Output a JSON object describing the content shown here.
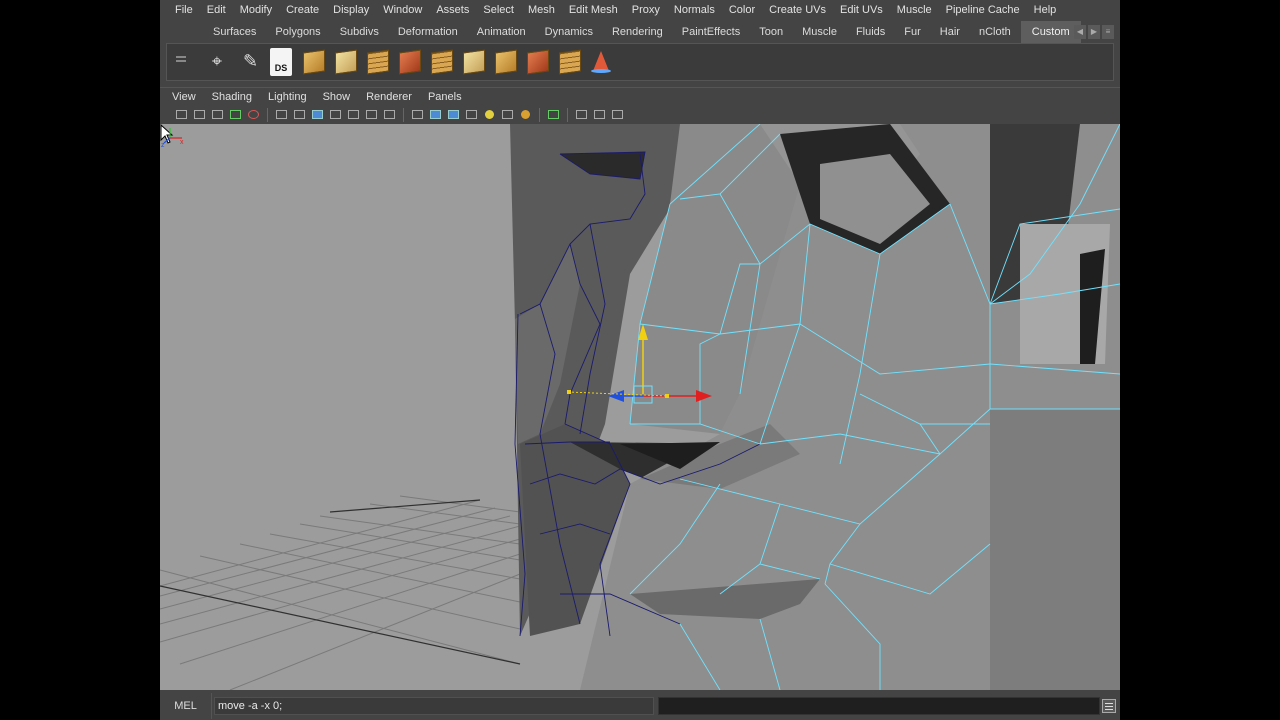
{
  "main_menu": [
    "File",
    "Edit",
    "Modify",
    "Create",
    "Display",
    "Window",
    "Assets",
    "Select",
    "Mesh",
    "Edit Mesh",
    "Proxy",
    "Normals",
    "Color",
    "Create UVs",
    "Edit UVs",
    "Muscle",
    "Pipeline Cache",
    "Help"
  ],
  "shelf_tabs": [
    "Surfaces",
    "Polygons",
    "Subdivs",
    "Deformation",
    "Animation",
    "Dynamics",
    "Rendering",
    "PaintEffects",
    "Toon",
    "Muscle",
    "Fluids",
    "Fur",
    "Hair",
    "nCloth",
    "Custom"
  ],
  "active_shelf_tab": "Custom",
  "shelf_icons": [
    "select-tool-icon",
    "paint-brush-icon",
    "ds-icon",
    "poly-cube-icon",
    "poly-plane-icon",
    "poly-pipe-icon",
    "poly-extrude-icon",
    "poly-split-icon",
    "poly-bevel-icon",
    "poly-grid-icon",
    "poly-smooth-icon",
    "poly-mesh-icon",
    "poly-cone-icon"
  ],
  "ds_label": "DS",
  "panel_menu": [
    "View",
    "Shading",
    "Lighting",
    "Show",
    "Renderer",
    "Panels"
  ],
  "command_line": {
    "label": "MEL",
    "value": "move -a -x 0;"
  },
  "colors": {
    "viewport_bg": "#9c9c9c",
    "ui_bg": "#444444",
    "wire_highlight": "#6fe3ff",
    "wire_dark": "#1a1a6e",
    "manip_x": "#e02020",
    "manip_y": "#f0d010",
    "manip_z": "#2050e0"
  }
}
